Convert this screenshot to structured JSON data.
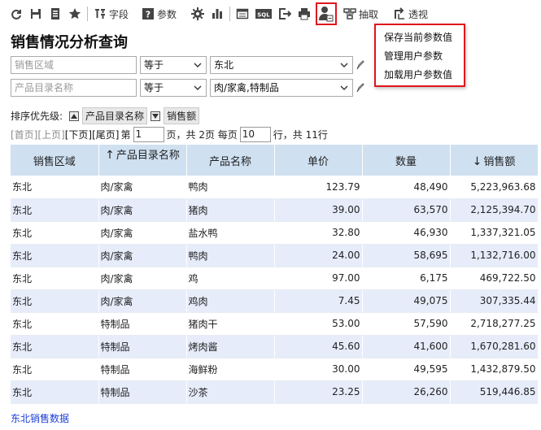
{
  "toolbar": {
    "field_label": "字段",
    "param_label": "参数",
    "extract_label": "抽取",
    "pivot_label": "透视",
    "sql_label": "SQL"
  },
  "user_param_menu": {
    "items": [
      "保存当前参数值",
      "管理用户参数",
      "加载用户参数值"
    ]
  },
  "page": {
    "title": "销售情况分析查询"
  },
  "filters": [
    {
      "field_placeholder": "销售区域",
      "operator": "等于",
      "value": "东北"
    },
    {
      "field_placeholder": "产品目录名称",
      "operator": "等于",
      "value": "肉/家禽,特制品"
    }
  ],
  "sort": {
    "label": "排序优先级:",
    "items": [
      {
        "name": "产品目录名称",
        "direction": "asc"
      },
      {
        "name": "销售额",
        "direction": "desc"
      }
    ]
  },
  "pager": {
    "first": "[首页]",
    "prev": "[上页]",
    "next": "[下页]",
    "last": "[尾页]",
    "page_prefix": "第",
    "current_page": "1",
    "page_mid": "页，共 2页 每页",
    "page_size": "10",
    "page_suffix": "行，共 11行"
  },
  "table": {
    "columns": [
      "销售区域",
      "产品目录名称",
      "产品名称",
      "单价",
      "数量",
      "销售额"
    ],
    "rows": [
      [
        "东北",
        "肉/家禽",
        "鸭肉",
        "123.79",
        "48,490",
        "5,223,963.68"
      ],
      [
        "东北",
        "肉/家禽",
        "猪肉",
        "39.00",
        "63,570",
        "2,125,394.70"
      ],
      [
        "东北",
        "肉/家禽",
        "盐水鸭",
        "32.80",
        "46,930",
        "1,337,321.05"
      ],
      [
        "东北",
        "肉/家禽",
        "鸭肉",
        "24.00",
        "58,695",
        "1,132,716.00"
      ],
      [
        "东北",
        "肉/家禽",
        "鸡",
        "97.00",
        "6,175",
        "469,722.50"
      ],
      [
        "东北",
        "肉/家禽",
        "鸡肉",
        "7.45",
        "49,075",
        "307,335.44"
      ],
      [
        "东北",
        "特制品",
        "猪肉干",
        "53.00",
        "57,590",
        "2,718,277.25"
      ],
      [
        "东北",
        "特制品",
        "烤肉酱",
        "45.60",
        "41,600",
        "1,670,281.60"
      ],
      [
        "东北",
        "特制品",
        "海鲜粉",
        "30.00",
        "49,595",
        "1,432,879.50"
      ],
      [
        "东北",
        "特制品",
        "沙茶",
        "23.25",
        "26,260",
        "519,446.85"
      ]
    ]
  },
  "footer": {
    "link": "东北销售数据"
  },
  "colors": {
    "accent_red": "#e0161c",
    "header_bg": "#cfe0f1",
    "row_alt": "#e6ecfa",
    "link_blue": "#1a3ed6"
  }
}
